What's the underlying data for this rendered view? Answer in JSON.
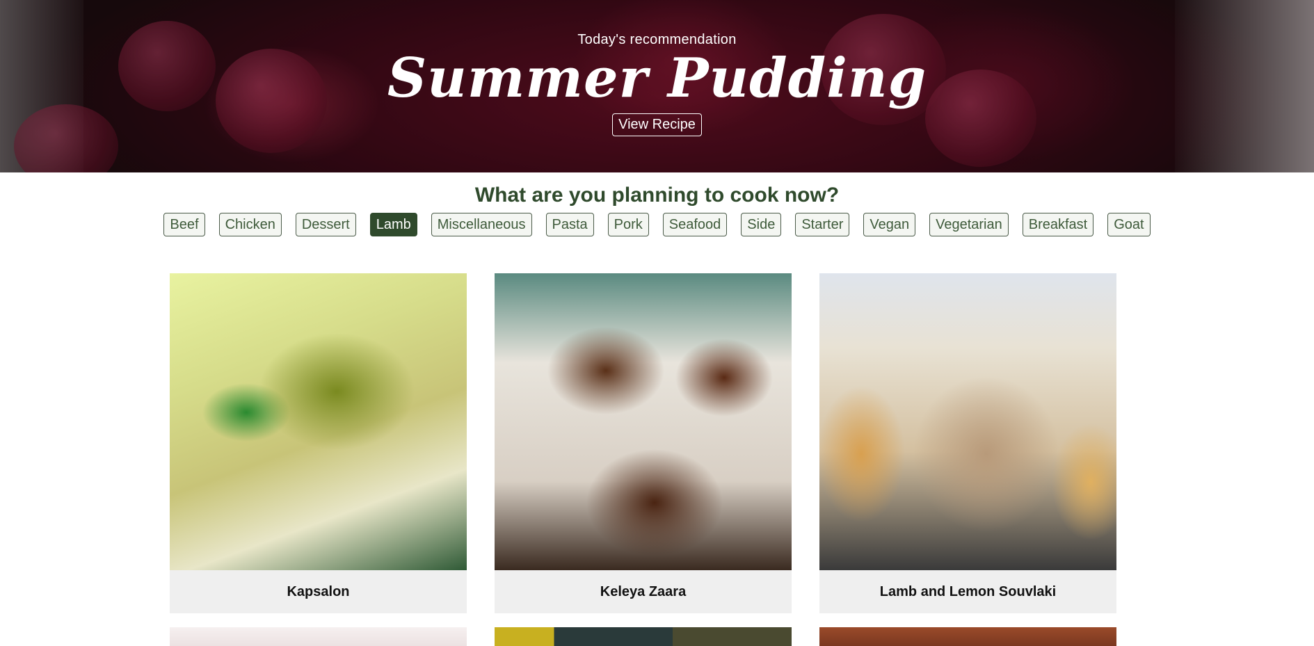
{
  "hero": {
    "subtitle": "Today's recommendation",
    "title": "Summer Pudding",
    "button_label": "View Recipe"
  },
  "categories_section": {
    "heading": "What are you planning to cook now?",
    "active": "Lamb",
    "items": [
      "Beef",
      "Chicken",
      "Dessert",
      "Lamb",
      "Miscellaneous",
      "Pasta",
      "Pork",
      "Seafood",
      "Side",
      "Starter",
      "Vegan",
      "Vegetarian",
      "Breakfast",
      "Goat"
    ]
  },
  "recipes": [
    {
      "name": "Kapsalon"
    },
    {
      "name": "Keleya Zaara"
    },
    {
      "name": "Lamb and Lemon Souvlaki"
    }
  ],
  "colors": {
    "accent": "#2f4a2c",
    "caption_bg": "#efefef"
  }
}
